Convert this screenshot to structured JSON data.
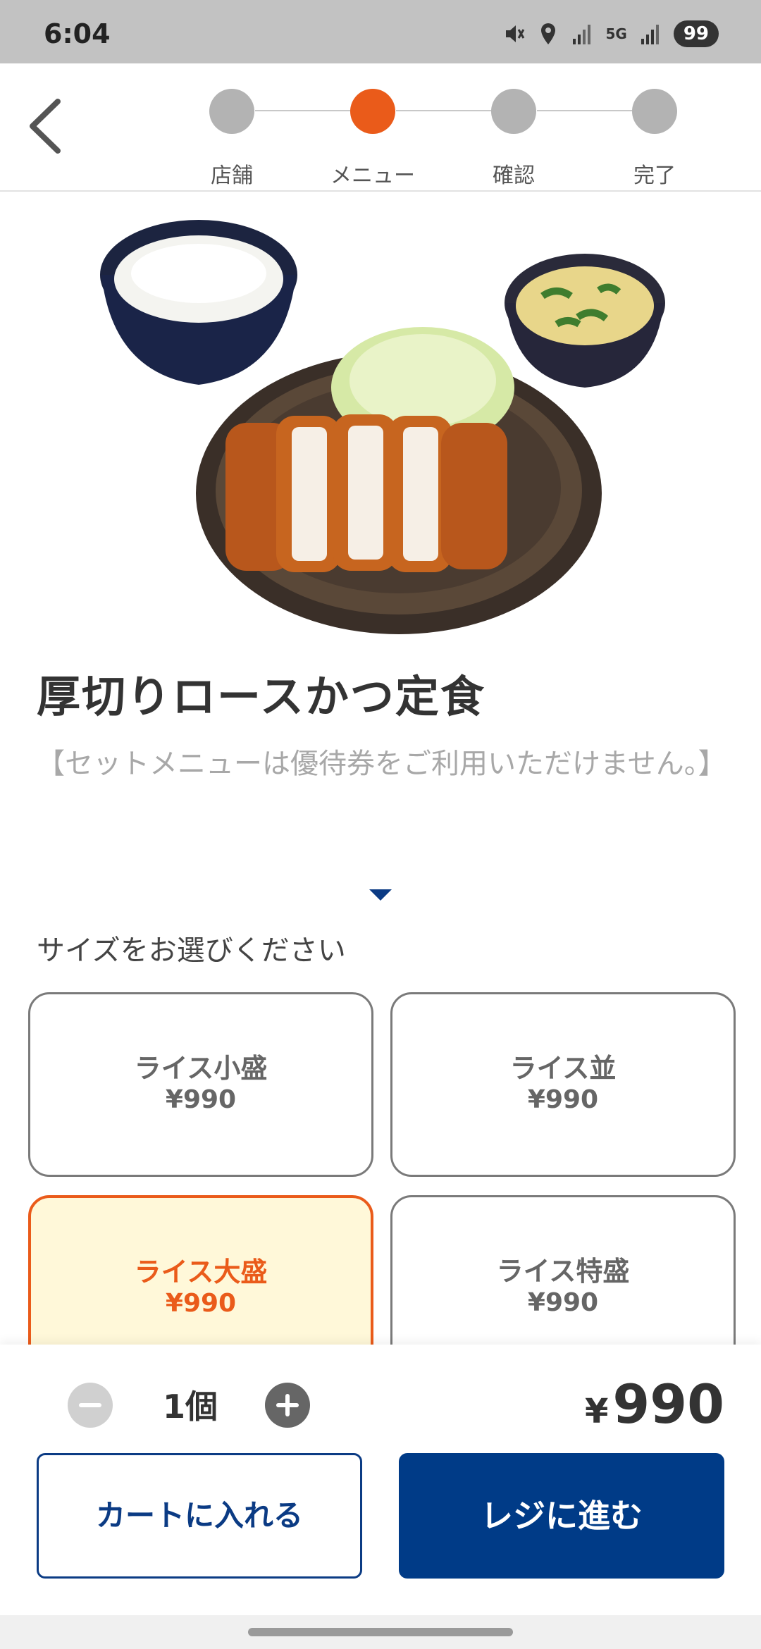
{
  "status_bar": {
    "time": "6:04",
    "battery": "99",
    "network": "5G",
    "icons": [
      "mute-icon",
      "location-icon",
      "signal-icon",
      "5g-icon",
      "signal-icon"
    ]
  },
  "stepper": {
    "steps": [
      {
        "label": "店舗",
        "active": false
      },
      {
        "label": "メニュー",
        "active": true
      },
      {
        "label": "確認",
        "active": false
      },
      {
        "label": "完了",
        "active": false
      }
    ]
  },
  "product": {
    "image": "tonkatsu-set-meal",
    "title": "厚切りロースかつ定食",
    "note": "【セットメニューは優待券をご利用いただけません。】"
  },
  "size_section": {
    "heading": "サイズをお選びください",
    "options": [
      {
        "name": "ライス小盛",
        "price": "¥990",
        "selected": false
      },
      {
        "name": "ライス並",
        "price": "¥990",
        "selected": false
      },
      {
        "name": "ライス大盛",
        "price": "¥990",
        "selected": true
      },
      {
        "name": "ライス特盛",
        "price": "¥990",
        "selected": false
      }
    ]
  },
  "order": {
    "quantity": "1個",
    "total_currency": "¥",
    "total_amount": "990",
    "cart_button": "カートに入れる",
    "checkout_button": "レジに進む"
  },
  "colors": {
    "accent": "#ea5b1a",
    "primary": "#003b87",
    "selected_bg": "#fff8d9"
  }
}
